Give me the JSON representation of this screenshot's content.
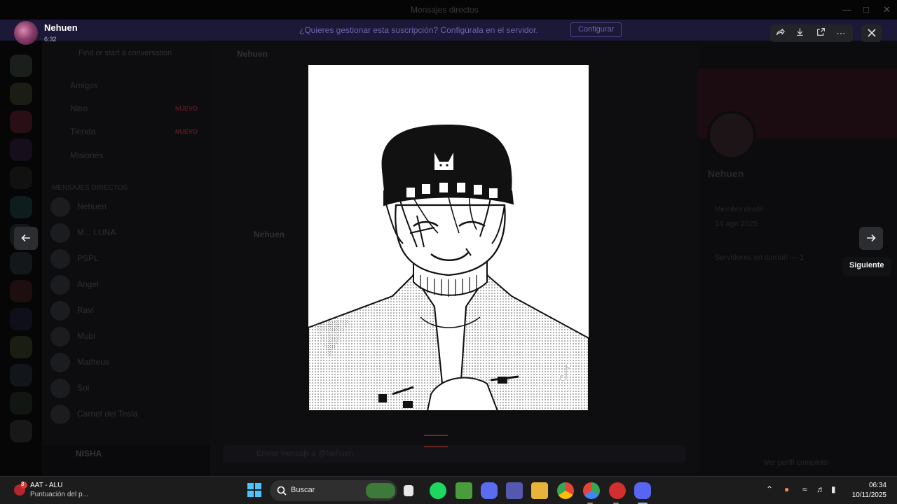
{
  "window": {
    "title": "Mensajes directos"
  },
  "banner": {
    "message": "¿Quieres gestionar esta suscripción? Configúrala en el servidor.",
    "button": "Configurar"
  },
  "sidebar": {
    "search_placeholder": "Find or start a conversation",
    "nav": [
      {
        "label": "Amigos",
        "badge": ""
      },
      {
        "label": "Nitro",
        "badge": "NUEVO"
      },
      {
        "label": "Tienda",
        "badge": "NUEVO"
      },
      {
        "label": "Misiones",
        "badge": ""
      }
    ],
    "section_label": "MENSAJES DIRECTOS",
    "dms": [
      "Nehuen",
      "M... LUNA",
      "PSPL",
      "Angel",
      "Ravi",
      "Mubi",
      "Matheus",
      "Sol",
      "Carnet del Tesla"
    ],
    "user": "NISHA"
  },
  "chat": {
    "header": "Nehuen",
    "author": "Nehuen",
    "composer_placeholder": "Enviar mensaje a @Nehuen"
  },
  "profile": {
    "name": "Nehuen",
    "member_since_label": "Miembro desde",
    "member_since": "14 ago 2025",
    "mutual_servers": "Servidores en común — 1",
    "footer": "Ver perfil completo"
  },
  "viewer": {
    "sender": "Nehuen",
    "time": "6:32",
    "next_tooltip": "Siguiente",
    "icons": [
      "share-icon",
      "download-icon",
      "open-external-icon",
      "more-icon",
      "close-icon",
      "arrow-left-icon",
      "arrow-right-icon"
    ]
  },
  "taskbar": {
    "notification_title": "AAT - ALU",
    "notification_subtitle": "Puntuación del p...",
    "notification_count": "3",
    "search_placeholder": "Buscar",
    "time": "06:34",
    "date": "10/11/2025"
  },
  "colors": {
    "overlay_bg": "#0b0b0d",
    "accent": "#5865f2",
    "taskbar": "#1c1c1c"
  }
}
